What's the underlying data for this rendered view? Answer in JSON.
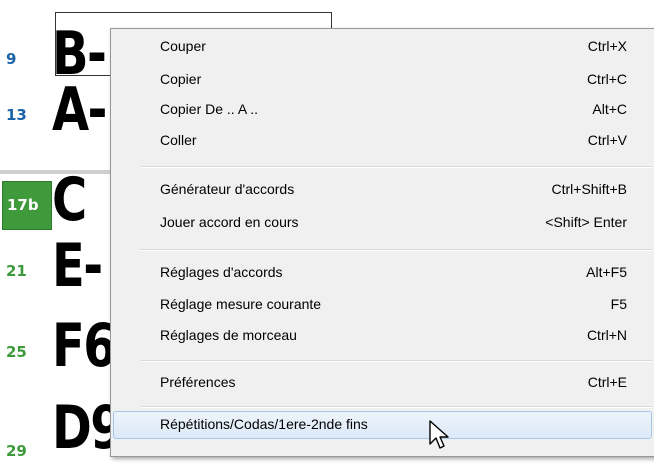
{
  "sheet": {
    "rows": [
      {
        "number": "9",
        "chord": "B-",
        "color": "#1a63a8"
      },
      {
        "number": "13",
        "chord": "A-",
        "color": "#1a63a8"
      },
      {
        "number": "17b",
        "chord": "C",
        "color": "#ffffff"
      },
      {
        "number": "21",
        "chord": "E-",
        "color": "#3e9a3a"
      },
      {
        "number": "25",
        "chord": "F6",
        "color": "#3e9a3a"
      },
      {
        "number": "29",
        "chord": "D9",
        "color": "#3e9a3a"
      }
    ]
  },
  "menu": {
    "items": [
      {
        "label": "Couper",
        "shortcut": "Ctrl+X"
      },
      {
        "label": "Copier",
        "shortcut": "Ctrl+C"
      },
      {
        "label": "Copier De .. A ..",
        "shortcut": "Alt+C"
      },
      {
        "label": "Coller",
        "shortcut": "Ctrl+V"
      },
      {
        "label": "Générateur d'accords",
        "shortcut": "Ctrl+Shift+B"
      },
      {
        "label": "Jouer accord en cours",
        "shortcut": "<Shift> Enter"
      },
      {
        "label": "Réglages d'accords",
        "shortcut": "Alt+F5"
      },
      {
        "label": "Réglage mesure courante",
        "shortcut": "F5"
      },
      {
        "label": "Réglages de morceau",
        "shortcut": "Ctrl+N"
      },
      {
        "label": "Préférences",
        "shortcut": "Ctrl+E"
      },
      {
        "label": "Répétitions/Codas/1ere-2nde fins",
        "shortcut": ""
      }
    ]
  },
  "colors": {
    "highlight": "#3e9a3a",
    "bar_number_blue": "#1a63a8",
    "bar_number_green": "#3e9a3a"
  }
}
